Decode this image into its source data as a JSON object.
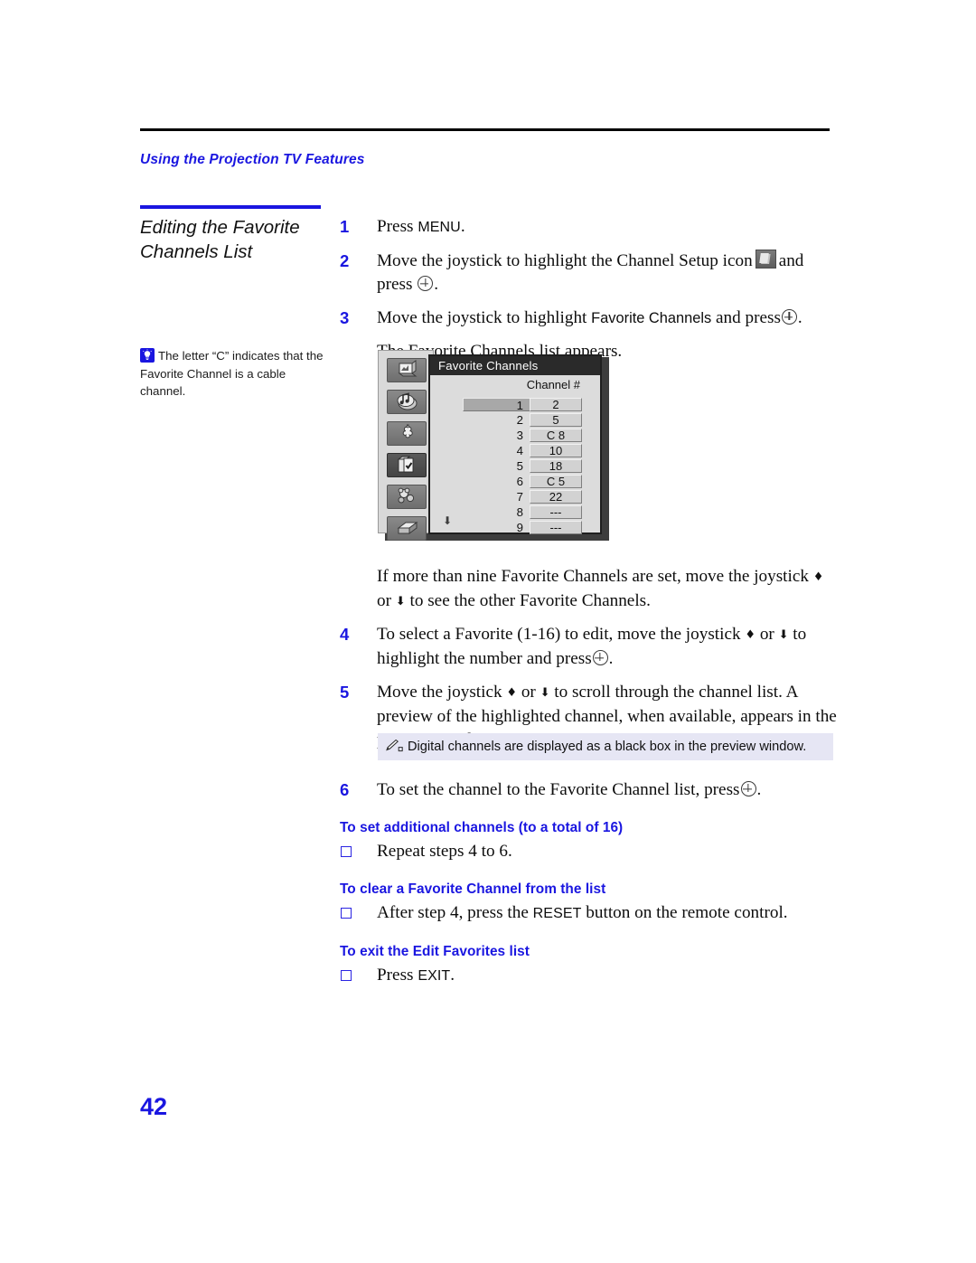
{
  "header": {
    "running_head": "Using the Projection TV Features"
  },
  "section": {
    "title": "Editing the Favorite Channels List"
  },
  "tip": {
    "icon": "lightbulb-tip-icon",
    "text": "The letter “C” indicates that the Favorite Channel is a cable channel."
  },
  "steps": [
    {
      "num": "1",
      "text_before": "Press ",
      "smallcaps": "MENU",
      "text_after": "."
    },
    {
      "num": "2",
      "part1": "Move the joystick to highlight the Channel Setup icon",
      "part2": "and press",
      "part3": "."
    },
    {
      "num": "3",
      "part1": "Move the joystick to highlight",
      "menu_label": "Favorite Channels",
      "part2": "and press",
      "part3": "."
    },
    {
      "num": "4",
      "part1": "To select a Favorite (1-16) to edit, move the joystick",
      "part2": "or",
      "part3": "to highlight the number and press",
      "part4": "."
    },
    {
      "num": "5",
      "text": "Move the joystick ♦ or ♦ to scroll through the channel list. A preview of the highlighted channel, when available, appears in the preview window."
    },
    {
      "num": "6",
      "part1": "To set the channel to the Favorite Channel list, press",
      "part2": "."
    }
  ],
  "step3_result": "The Favorite Channels list appears.",
  "after_figure": {
    "part1": "If more than nine Favorite Channels are set, move the joystick",
    "part2": "or",
    "part3": "to see the other Favorite Channels."
  },
  "step5_text": {
    "part1": "Move the joystick",
    "part2": "or",
    "part3": "to scroll through the channel list. A preview of the highlighted channel, when available, appears in the preview window."
  },
  "figure": {
    "title": "Favorite Channels",
    "column_header": "Channel #",
    "scroll_arrow": "⬇",
    "sidebar_icons": [
      "video-settings-icon",
      "audio-settings-icon",
      "screen-settings-icon",
      "channel-setup-icon",
      "parental-lock-icon",
      "setup-icon"
    ],
    "selected_sidebar_index": 3,
    "rows": [
      {
        "index": "1",
        "channel": "2",
        "selected": true
      },
      {
        "index": "2",
        "channel": "5",
        "selected": false
      },
      {
        "index": "3",
        "channel": "C 8",
        "selected": false
      },
      {
        "index": "4",
        "channel": "10",
        "selected": false
      },
      {
        "index": "5",
        "channel": "18",
        "selected": false
      },
      {
        "index": "6",
        "channel": "C 5",
        "selected": false
      },
      {
        "index": "7",
        "channel": "22",
        "selected": false
      },
      {
        "index": "8",
        "channel": "---",
        "selected": false
      },
      {
        "index": "9",
        "channel": "---",
        "selected": false
      }
    ]
  },
  "note": {
    "icon": "note-pencil-icon",
    "text": "Digital channels are displayed as a black box in the preview window."
  },
  "tail": [
    {
      "heading": "To set additional channels (to a total of 16)",
      "bullet": "Repeat steps 4 to 6."
    },
    {
      "heading": "To clear a Favorite Channel from the list",
      "bullet_before": "After step 4, press the ",
      "bullet_smallcaps": "RESET",
      "bullet_after": " button on the remote control."
    },
    {
      "heading": "To exit the Edit Favorites list",
      "bullet_before": "Press ",
      "bullet_smallcaps": "EXIT",
      "bullet_after": "."
    }
  ],
  "page_number": "42",
  "colors": {
    "accent_blue": "#1a16e0",
    "note_background": "#e6e6f4",
    "rule_black": "#000000"
  }
}
